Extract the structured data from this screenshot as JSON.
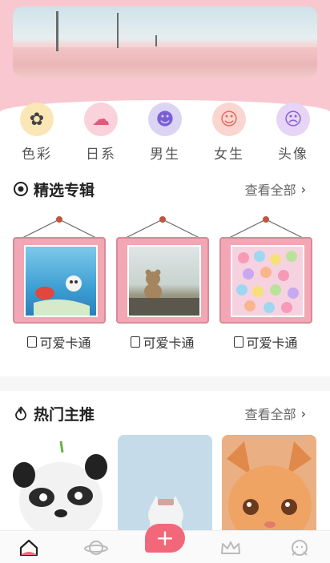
{
  "categories": [
    {
      "label": "色彩",
      "icon": "flower-icon",
      "color": "#fbe6b5"
    },
    {
      "label": "日系",
      "icon": "rabbit-icon",
      "color": "#fad2dc"
    },
    {
      "label": "男生",
      "icon": "boy-face-icon",
      "color": "#dcd4f3"
    },
    {
      "label": "女生",
      "icon": "girl-face-icon",
      "color": "#fbd5d0"
    },
    {
      "label": "头像",
      "icon": "avatar-icon",
      "color": "#e6d5f5"
    }
  ],
  "featured": {
    "title": "精选专辑",
    "see_all": "查看全部",
    "albums": [
      {
        "label": "可爱卡通"
      },
      {
        "label": "可爱卡通"
      },
      {
        "label": "可爱卡通"
      }
    ]
  },
  "hot": {
    "title": "热门主推",
    "see_all": "查看全部"
  },
  "nav": {
    "add_label": "+"
  },
  "colors": {
    "accent": "#f2687a",
    "header_pink": "#f9c7cf",
    "frame_pink": "#f3a6b3"
  }
}
